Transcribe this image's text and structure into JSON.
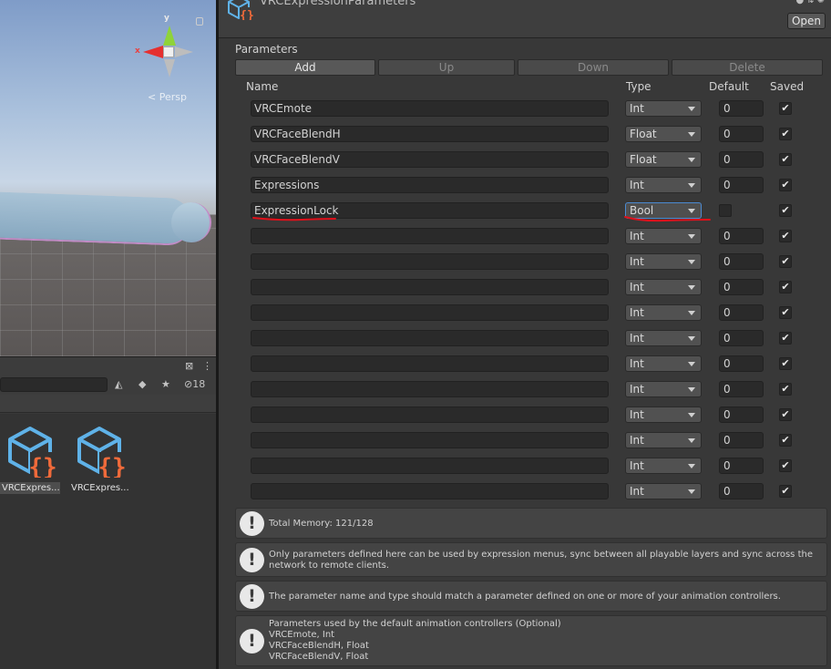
{
  "scene": {
    "gizmo_axis_x": "x",
    "gizmo_axis_y": "y",
    "projection_label": "< Persp"
  },
  "project": {
    "hidden_count_label": "18",
    "assets": [
      {
        "label": "VRCExpres...",
        "selected": true
      },
      {
        "label": "VRCExpres...",
        "selected": false
      }
    ]
  },
  "inspector": {
    "title": "VRCExpressionParameters",
    "open_label": "Open",
    "section_label": "Parameters",
    "buttons": {
      "add": "Add",
      "up": "Up",
      "down": "Down",
      "delete": "Delete"
    },
    "columns": {
      "name": "Name",
      "type": "Type",
      "default": "Default",
      "saved": "Saved"
    },
    "rows": [
      {
        "name": "VRCEmote",
        "type": "Int",
        "default": "0",
        "saved": "✔"
      },
      {
        "name": "VRCFaceBlendH",
        "type": "Float",
        "default": "0",
        "saved": "✔"
      },
      {
        "name": "VRCFaceBlendV",
        "type": "Float",
        "default": "0",
        "saved": "✔"
      },
      {
        "name": "Expressions",
        "type": "Int",
        "default": "0",
        "saved": "✔"
      },
      {
        "name": "ExpressionLock",
        "type": "Bool",
        "default": "",
        "saved": "✔"
      },
      {
        "name": "",
        "type": "Int",
        "default": "0",
        "saved": "✔"
      },
      {
        "name": "",
        "type": "Int",
        "default": "0",
        "saved": "✔"
      },
      {
        "name": "",
        "type": "Int",
        "default": "0",
        "saved": "✔"
      },
      {
        "name": "",
        "type": "Int",
        "default": "0",
        "saved": "✔"
      },
      {
        "name": "",
        "type": "Int",
        "default": "0",
        "saved": "✔"
      },
      {
        "name": "",
        "type": "Int",
        "default": "0",
        "saved": "✔"
      },
      {
        "name": "",
        "type": "Int",
        "default": "0",
        "saved": "✔"
      },
      {
        "name": "",
        "type": "Int",
        "default": "0",
        "saved": "✔"
      },
      {
        "name": "",
        "type": "Int",
        "default": "0",
        "saved": "✔"
      },
      {
        "name": "",
        "type": "Int",
        "default": "0",
        "saved": "✔"
      },
      {
        "name": "",
        "type": "Int",
        "default": "0",
        "saved": "✔"
      }
    ],
    "info": {
      "memory": "Total Memory: 121/128",
      "sync": [
        "Only parameters defined here can be used by expression menus, sync between all playable layers and sync across the",
        "network to remote clients."
      ],
      "match": "The parameter name and type should match a parameter defined on one or more of your animation controllers.",
      "defaults": [
        "Parameters used by the default animation controllers (Optional)",
        "VRCEmote, Int",
        "VRCFaceBlendH, Float",
        "VRCFaceBlendV, Float"
      ]
    }
  },
  "colors": {
    "annotation": "#e0101a",
    "icon_blue": "#5fb2e8",
    "icon_orange": "#f06a3a",
    "focus": "#4b8ad1"
  }
}
